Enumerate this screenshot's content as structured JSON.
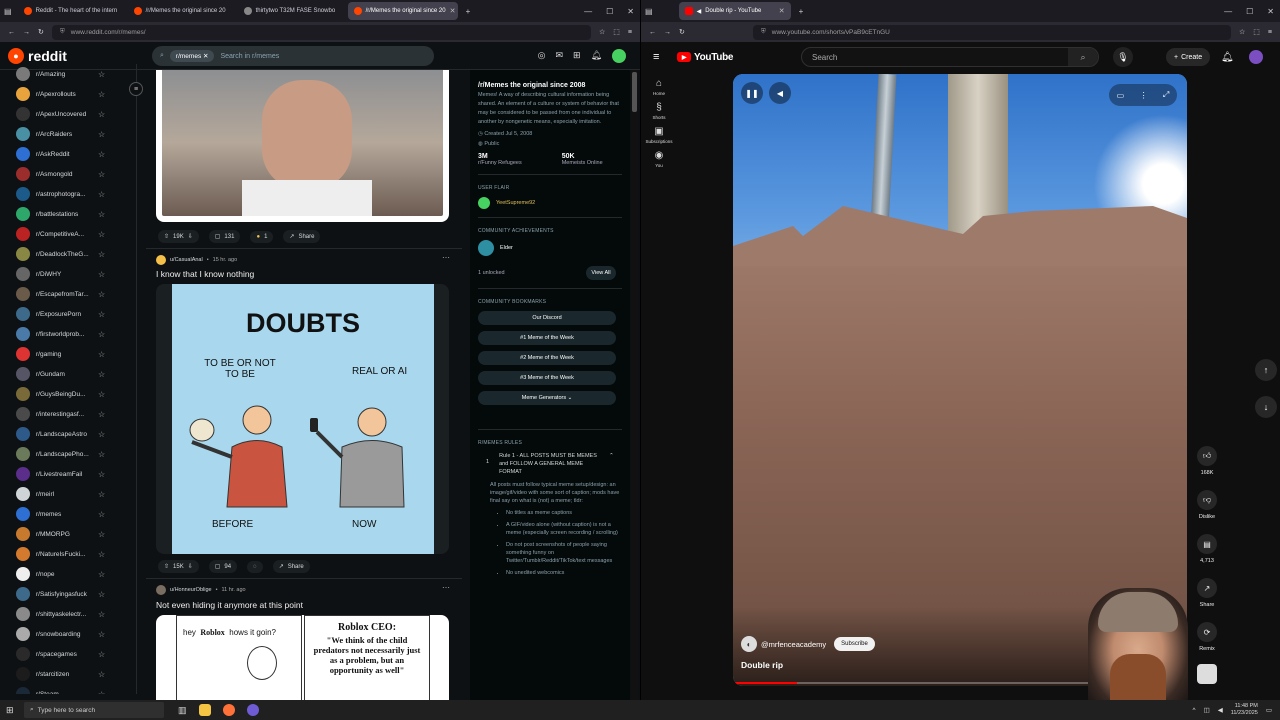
{
  "left_browser": {
    "tabs": [
      {
        "label": "Reddit - The heart of the intern",
        "active": false,
        "color": "#ff4500"
      },
      {
        "label": "/r/Memes the original since 20",
        "active": false,
        "color": "#ff4500"
      },
      {
        "label": "thirtytwo T32M FASE Snowbo",
        "active": false,
        "color": "#888888"
      },
      {
        "label": "/r/Memes the original since 20",
        "active": true,
        "color": "#ff4500"
      }
    ],
    "url": "www.reddit.com/r/memes/"
  },
  "reddit": {
    "logo": "reddit",
    "search_chip": "r/memes",
    "search_placeholder": "Search in r/memes",
    "sidebar": [
      "r/Amazing",
      "r/Apexrollouts",
      "r/ApexUncovered",
      "r/ArcRaiders",
      "r/AskReddit",
      "r/Asmongold",
      "r/astrophotogra...",
      "r/battlestations",
      "r/CompetitiveA...",
      "r/DeadlockTheG...",
      "r/DiWHY",
      "r/EscapefromTar...",
      "r/ExposurePorn",
      "r/firstworldprob...",
      "r/gaming",
      "r/Gundam",
      "r/GuysBeingDu...",
      "r/interestingasf...",
      "r/LandscapeAstro",
      "r/LandscapePho...",
      "r/LivestreamFail",
      "r/meirl",
      "r/memes",
      "r/MMORPG",
      "r/NatureIsFucki...",
      "r/nope",
      "r/Satisfyingasfuck",
      "r/shittyaskelectr...",
      "r/snowboarding",
      "r/spacegames",
      "r/starcitizen",
      "r/Steam"
    ],
    "post1": {
      "votes": "19K",
      "comments": "131",
      "awards": "1",
      "share": "Share"
    },
    "post2": {
      "user": "u/CasualAnal",
      "time": "15 hr. ago",
      "title": "I know that I know nothing",
      "meme_title": "DOUBTS",
      "left_caption": "TO BE OR NOT TO BE",
      "right_caption": "REAL OR AI",
      "left_label": "BEFORE",
      "right_label": "NOW",
      "votes": "15K",
      "comments": "94",
      "share": "Share"
    },
    "post3": {
      "user": "u/HonneurOblige",
      "time": "11 hr. ago",
      "title": "Not even hiding it anymore at this point",
      "hey": "hey",
      "roblox": "Roblox",
      "hows": "hows it goin?",
      "ceo": "Roblox CEO:",
      "quote": "\"We think of the child predators not necessarily just as a problem, but an opportunity as well\""
    },
    "community": {
      "title": "/r/Memes the original since 2008",
      "desc": "Memes! A way of describing cultural information being shared. An element of a culture or system of behavior that may be considered to be passed from one individual to another by nongenetic means, especially imitation.",
      "created": "Created Jul 5, 2008",
      "visibility": "Public",
      "members": "3M",
      "members_label": "r/Funny Refugees",
      "online": "50K",
      "online_label": "Memeists Online",
      "user_flair_h": "USER FLAIR",
      "flair_user": "YeetSupreme92",
      "ach_h": "COMMUNITY ACHIEVEMENTS",
      "ach": "Elder",
      "unlocked": "1 unlocked",
      "view_all": "View All",
      "bookmarks_h": "COMMUNITY BOOKMARKS",
      "bookmarks": [
        "Our Discord",
        "#1 Meme of the Week",
        "#2 Meme of the Week",
        "#3 Meme of the Week",
        "Meme Generators"
      ],
      "rules_h": "R/MEMES RULES",
      "rule_num": "1",
      "rule_title": "Rule 1 - ALL POSTS MUST BE MEMES and FOLLOW A GENERAL MEME FORMAT",
      "rule_body": "All posts must follow typical meme setup/design: an image/gif/video with some sort of caption; mods have final say on what is (not) a meme; tldr:",
      "rule_items": [
        "No titles as meme captions",
        "A GIF/video alone (without caption) is not a meme (especially screen recording / scrolling)",
        "Do not post screenshots of people saying something funny on Twitter/Tumblr/Reddit/TikTok/text messages",
        "No unedited webcomics"
      ]
    }
  },
  "right_browser": {
    "tab": "Double rip - YouTube",
    "url": "www.youtube.com/shorts/vPaB9cETnGU"
  },
  "youtube": {
    "logo": "YouTube",
    "search_placeholder": "Search",
    "create": "Create",
    "rail": [
      "Home",
      "Shorts",
      "Subscriptions",
      "You"
    ],
    "channel": "@mrfenceacademy",
    "subscribe": "Subscribe",
    "title": "Double rip",
    "likes": "168K",
    "dislike": "Dislike",
    "comments": "4,713",
    "share": "Share",
    "remix": "Remix"
  },
  "taskbar": {
    "search": "Type here to search",
    "time": "11:48 PM",
    "date": "11/23/2025"
  }
}
